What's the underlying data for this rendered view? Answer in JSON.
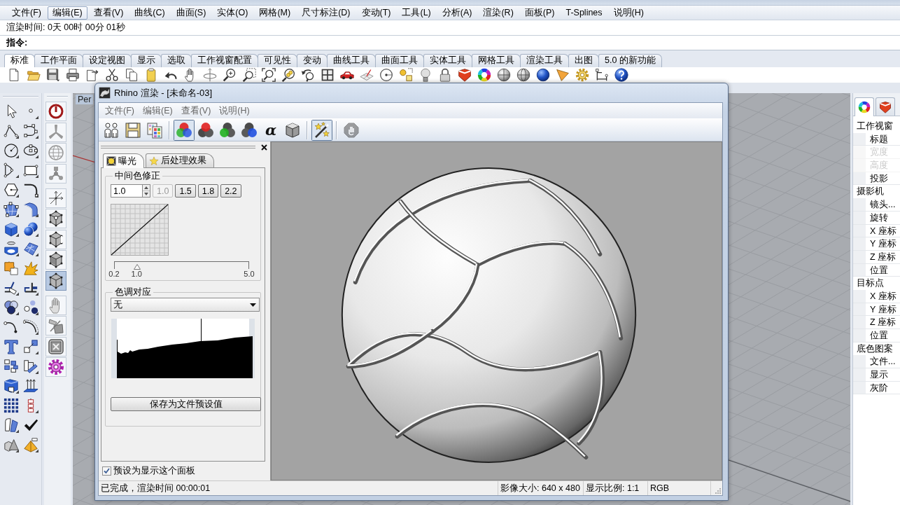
{
  "menu_bar": [
    {
      "label": "文件(F)",
      "selected": false
    },
    {
      "label": "编辑(E)",
      "selected": true
    },
    {
      "label": "查看(V)",
      "selected": false
    },
    {
      "label": "曲线(C)",
      "selected": false
    },
    {
      "label": "曲面(S)",
      "selected": false
    },
    {
      "label": "实体(O)",
      "selected": false
    },
    {
      "label": "网格(M)",
      "selected": false
    },
    {
      "label": "尺寸标注(D)",
      "selected": false
    },
    {
      "label": "变动(T)",
      "selected": false
    },
    {
      "label": "工具(L)",
      "selected": false
    },
    {
      "label": "分析(A)",
      "selected": false
    },
    {
      "label": "渲染(R)",
      "selected": false
    },
    {
      "label": "面板(P)",
      "selected": false
    },
    {
      "label": "T-Splines",
      "selected": false
    },
    {
      "label": "说明(H)",
      "selected": false
    }
  ],
  "command_history": {
    "text": "渲染时间: 0天 00时 00分 01秒"
  },
  "command_line": {
    "prompt": "指令:"
  },
  "toolbar_tabs": [
    {
      "label": "标准",
      "selected": true
    },
    {
      "label": "工作平面",
      "selected": false
    },
    {
      "label": "设定视图",
      "selected": false
    },
    {
      "label": "显示",
      "selected": false
    },
    {
      "label": "选取",
      "selected": false
    },
    {
      "label": "工作视窗配置",
      "selected": false
    },
    {
      "label": "可见性",
      "selected": false
    },
    {
      "label": "变动",
      "selected": false
    },
    {
      "label": "曲线工具",
      "selected": false
    },
    {
      "label": "曲面工具",
      "selected": false
    },
    {
      "label": "实体工具",
      "selected": false
    },
    {
      "label": "网格工具",
      "selected": false
    },
    {
      "label": "渲染工具",
      "selected": false
    },
    {
      "label": "出图",
      "selected": false
    },
    {
      "label": "5.0 的新功能",
      "selected": false
    }
  ],
  "viewport": {
    "title": "Per"
  },
  "left_toolbar": {
    "groups": [
      [
        {
          "selected": false
        },
        {
          "selected": false
        },
        {
          "selected": false
        },
        {
          "selected": false
        }
      ],
      [
        {
          "selected": false
        },
        {
          "selected": false
        },
        {
          "selected": false
        },
        {
          "selected": false
        },
        {
          "selected": true
        }
      ],
      [
        {
          "selected": false
        },
        {
          "selected": false
        },
        {
          "selected": false
        },
        {
          "selected": false
        }
      ]
    ]
  },
  "side_panel": {
    "tabs": [
      {
        "selected": true
      },
      {
        "selected": false
      }
    ],
    "sections": [
      {
        "title": "工作视窗",
        "items": [
          {
            "label": "标题",
            "disabled": false
          },
          {
            "label": "宽度",
            "disabled": true
          },
          {
            "label": "高度",
            "disabled": true
          },
          {
            "label": "投影",
            "disabled": false
          }
        ]
      },
      {
        "title": "摄影机",
        "items": [
          {
            "label": "镜头...",
            "disabled": false
          },
          {
            "label": "旋转",
            "disabled": false
          },
          {
            "label": "X 座标",
            "disabled": false
          },
          {
            "label": "Y 座标",
            "disabled": false
          },
          {
            "label": "Z 座标",
            "disabled": false
          },
          {
            "label": "位置",
            "disabled": false
          }
        ]
      },
      {
        "title": "目标点",
        "items": [
          {
            "label": "X 座标",
            "disabled": false
          },
          {
            "label": "Y 座标",
            "disabled": false
          },
          {
            "label": "Z 座标",
            "disabled": false
          },
          {
            "label": "位置",
            "disabled": false
          }
        ]
      },
      {
        "title": "底色图案",
        "items": [
          {
            "label": "文件...",
            "disabled": false
          },
          {
            "label": "显示",
            "disabled": false
          },
          {
            "label": "灰阶",
            "disabled": false
          }
        ]
      }
    ]
  },
  "render_window": {
    "title": "Rhino 渲染 - [未命名-03]",
    "menu": [
      "文件(F)",
      "编辑(E)",
      "查看(V)",
      "说明(H)"
    ],
    "toolbar": [
      [
        {
          "selected": false,
          "disabled": false
        },
        {
          "selected": false,
          "disabled": false
        },
        {
          "selected": false,
          "disabled": false
        }
      ],
      [
        {
          "selected": true,
          "disabled": false
        },
        {
          "selected": false,
          "disabled": false
        },
        {
          "selected": false,
          "disabled": false
        },
        {
          "selected": false,
          "disabled": false
        },
        {
          "label": "α",
          "selected": false,
          "disabled": false
        },
        {
          "selected": false,
          "disabled": false
        }
      ],
      [
        {
          "selected": true,
          "disabled": false
        }
      ],
      [
        {
          "selected": false,
          "disabled": true
        }
      ]
    ],
    "panel": {
      "tabs": [
        {
          "label": "曝光",
          "selected": true
        },
        {
          "label": "后处理效果",
          "selected": false
        }
      ],
      "midtone": {
        "title": "中间色修正",
        "value": "1.0",
        "presets": [
          {
            "label": "1.0",
            "disabled": true
          },
          {
            "label": "1.5",
            "disabled": false
          },
          {
            "label": "1.8",
            "disabled": false
          },
          {
            "label": "2.2",
            "disabled": false
          }
        ],
        "slider": {
          "level": 0.167,
          "labels": [
            "0.2",
            "1.0",
            "5.0"
          ]
        }
      },
      "tone_mapping": {
        "title": "色调对应",
        "value": "无"
      },
      "save_button": "保存为文件预设值",
      "default_panel": {
        "label": "预设为显示这个面板",
        "checked": true
      }
    },
    "status_bar": [
      "已完成，渲染时间 00:00:01",
      "影像大小: 640 x 480",
      "显示比例: 1:1",
      "RGB"
    ]
  }
}
